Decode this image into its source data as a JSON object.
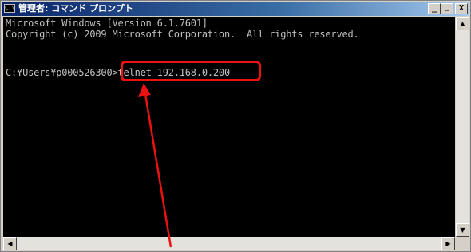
{
  "window": {
    "title": "管理者: コマンド プロンプト",
    "icon_label": "C:\\"
  },
  "title_buttons": {
    "minimize": "_",
    "maximize": "□",
    "close": "X"
  },
  "console": {
    "lines": [
      "Microsoft Windows [Version 6.1.7601]",
      "Copyright (c) 2009 Microsoft Corporation.  All rights reserved.",
      "",
      "C:¥Users¥p000526300>telnet 192.168.0.200"
    ]
  },
  "scrollbar": {
    "up": "▲",
    "down": "▼",
    "left": "◀",
    "right": "▶"
  },
  "colors": {
    "console_bg": "#000000",
    "console_text": "#c0c0c0",
    "highlight": "#ee1111",
    "titlebar": "#0a246a"
  },
  "annotation": {
    "highlighted_command": "telnet 192.168.0.200"
  }
}
